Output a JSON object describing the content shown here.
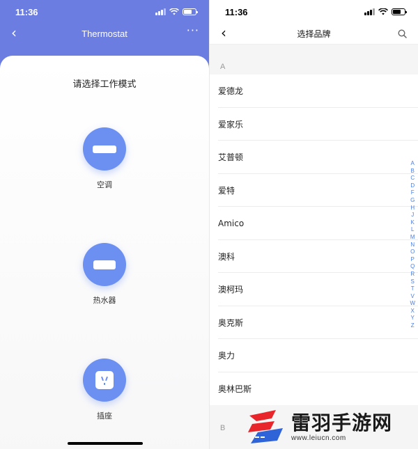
{
  "left": {
    "status": {
      "time": "11:36"
    },
    "nav": {
      "back": "‹",
      "title": "Thermostat",
      "more": "···"
    },
    "heading": "请选择工作模式",
    "modes": [
      {
        "label": "空调",
        "icon": "air-conditioner-icon"
      },
      {
        "label": "热水器",
        "icon": "water-heater-icon"
      },
      {
        "label": "插座",
        "icon": "socket-icon"
      }
    ],
    "accent": "#6c90f2",
    "header_color": "#6b7de0"
  },
  "right": {
    "status": {
      "time": "11:36"
    },
    "nav": {
      "back": "‹",
      "title": "选择品牌"
    },
    "sections": [
      {
        "letter": "A",
        "brands": [
          "爱德龙",
          "爱家乐",
          "艾普顿",
          "爱特",
          "Amico",
          "澳科",
          "澳柯玛",
          "奥克斯",
          "奥力",
          "奥林巴斯"
        ]
      },
      {
        "letter": "B",
        "brands": []
      }
    ],
    "index": [
      "A",
      "B",
      "C",
      "D",
      "F",
      "G",
      "H",
      "J",
      "K",
      "L",
      "M",
      "N",
      "O",
      "P",
      "Q",
      "R",
      "S",
      "T",
      "V",
      "W",
      "X",
      "Y",
      "Z"
    ],
    "index_color": "#4a7de6"
  },
  "watermark": {
    "title": "雷羽手游网",
    "url": "www.leiucn.com"
  }
}
